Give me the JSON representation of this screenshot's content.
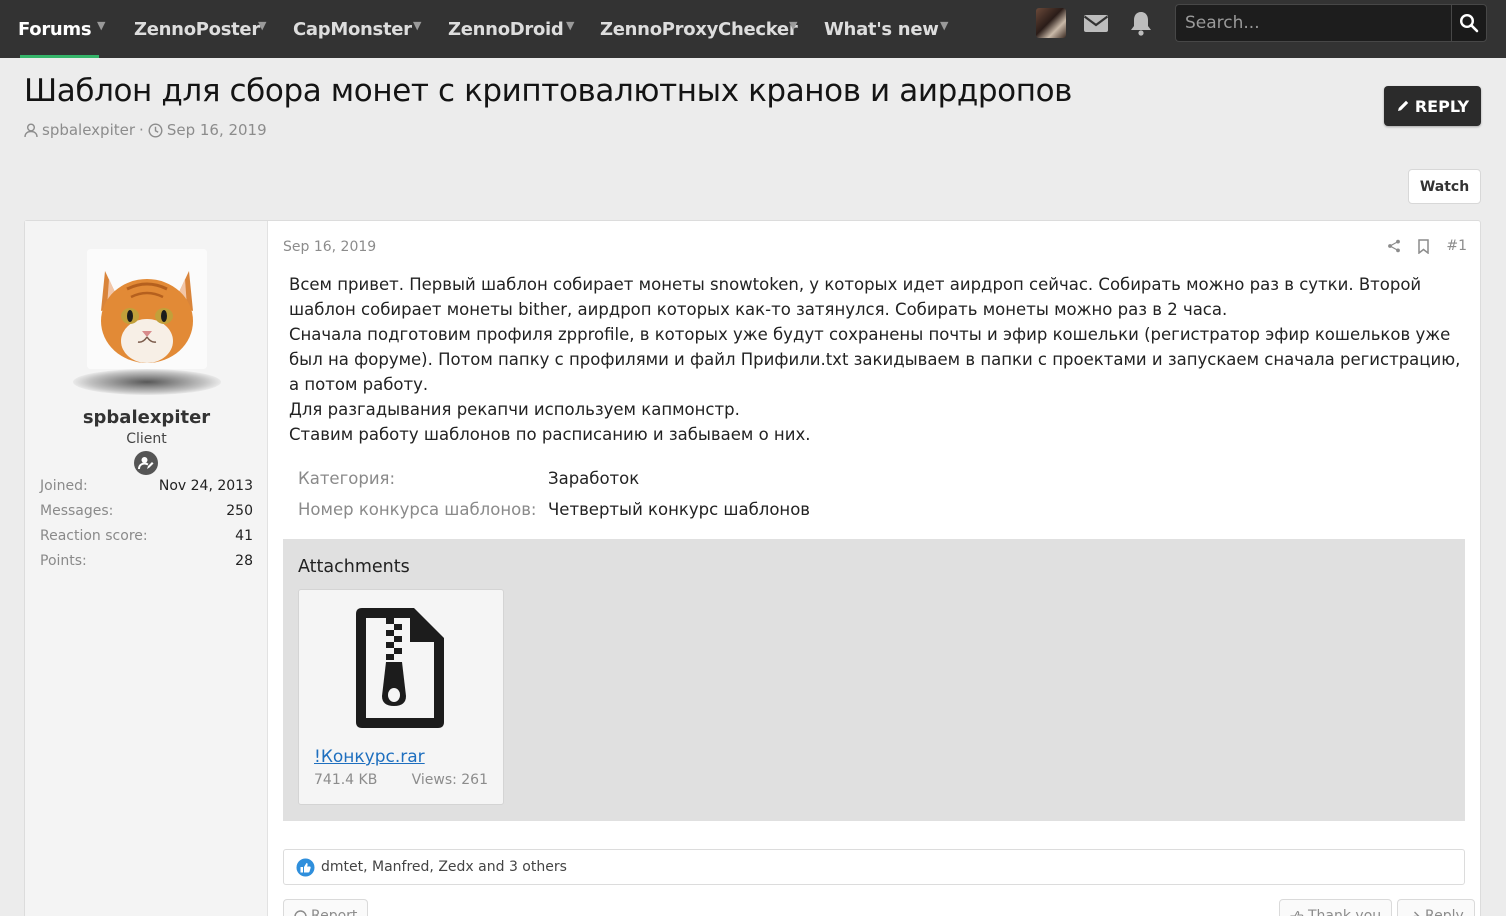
{
  "nav": {
    "items": [
      {
        "label": "Forums"
      },
      {
        "label": "ZennoPoster"
      },
      {
        "label": "CapMonster"
      },
      {
        "label": "ZennoDroid"
      },
      {
        "label": "ZennoProxyChecker"
      },
      {
        "label": "What's new"
      }
    ],
    "search_placeholder": "Search..."
  },
  "thread": {
    "title": "Шаблон для сбора монет с криптовалютных кранов и аирдропов",
    "author": "spbalexpiter",
    "separator": "·",
    "date": "Sep 16, 2019",
    "reply_label": "REPLY",
    "watch_label": "Watch"
  },
  "user": {
    "name": "spbalexpiter",
    "title": "Client",
    "stats": [
      {
        "key": "Joined:",
        "value": "Nov 24, 2013"
      },
      {
        "key": "Messages:",
        "value": "250"
      },
      {
        "key": "Reaction score:",
        "value": "41"
      },
      {
        "key": "Points:",
        "value": "28"
      }
    ]
  },
  "post": {
    "date": "Sep 16, 2019",
    "number": "#1",
    "body": [
      "Всем привет. Первый шаблон собирает монеты snowtoken, у которых идет аирдроп сейчас. Собирать можно раз в сутки. Второй шаблон собирает монеты bither, аирдроп которых как-то затянулся. Собирать монеты можно раз в 2 часа.",
      "Сначала подготовим профиля zpprofile, в которых уже будут сохранены почты и эфир кошельки (регистратор эфир кошельков уже был на форуме). Потом папку с профилями и файл Прифили.txt закидываем в папки с проектами и запускаем сначала регистрацию, а потом работу.",
      "Для разгадывания рекапчи используем капмонстр.",
      "Ставим работу шаблонов по расписанию и забываем о них."
    ],
    "fields": [
      {
        "key": "Категория:",
        "value": "Заработок"
      },
      {
        "key": "Номер конкурса шаблонов:",
        "value": "Четвертый конкурс шаблонов"
      }
    ],
    "attachments_title": "Attachments",
    "attachment": {
      "name": "!Конкурс.rar",
      "size": "741.4 KB",
      "views": "Views: 261"
    },
    "reactions_text": "dmtet, Manfred, Zedx and 3 others",
    "report_label": "Report",
    "thank_label": "Thank you",
    "reply_label": "Reply"
  },
  "colors": {
    "nav_bg": "#333333",
    "accent": "#35b56a",
    "link": "#1e6fbf"
  }
}
